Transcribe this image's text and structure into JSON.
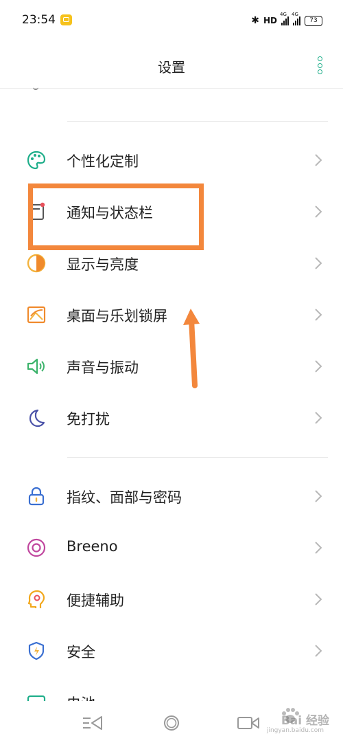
{
  "status_bar": {
    "time": "23:54",
    "hd": "HD",
    "network_1": "4G",
    "network_2": "4G",
    "battery": "73"
  },
  "header": {
    "title": "设置"
  },
  "menu": [
    {
      "label": "个性化定制",
      "icon": "palette-icon",
      "icon_color": "#1fae8a"
    },
    {
      "label": "通知与状态栏",
      "icon": "notification-icon",
      "icon_color": "#555555"
    },
    {
      "label": "显示与亮度",
      "icon": "brightness-icon",
      "icon_color": "#f08a2c"
    },
    {
      "label": "桌面与乐划锁屏",
      "icon": "wallpaper-icon",
      "icon_color": "#f08a2c"
    },
    {
      "label": "声音与振动",
      "icon": "speaker-icon",
      "icon_color": "#3cb36b"
    },
    {
      "label": "免打扰",
      "icon": "moon-icon",
      "icon_color": "#4a52a8"
    },
    {
      "label": "指纹、面部与密码",
      "icon": "lock-icon",
      "icon_color": "#3a6fd1"
    },
    {
      "label": "Breeno",
      "icon": "breeno-icon",
      "icon_color": "#c0469e"
    },
    {
      "label": "便捷辅助",
      "icon": "assist-icon",
      "icon_color": "#f2a81d"
    },
    {
      "label": "安全",
      "icon": "shield-icon",
      "icon_color": "#3a6fd1"
    },
    {
      "label": "电池",
      "icon": "battery-icon",
      "icon_color": "#1fae8a"
    }
  ],
  "annotation": {
    "highlight_color": "#f3873c"
  },
  "watermark": {
    "text": "Bai 经验",
    "sub": "jingyan.baidu.com"
  }
}
